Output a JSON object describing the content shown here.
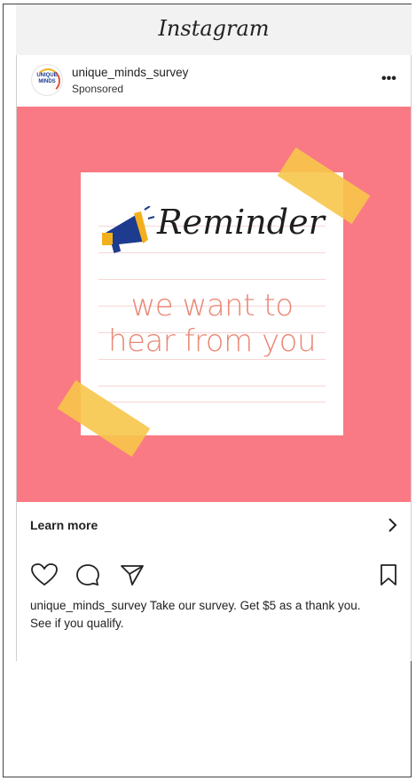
{
  "app": {
    "title": "Instagram"
  },
  "post": {
    "username": "unique_minds_survey",
    "sponsored_label": "Sponsored",
    "avatar_text": "UNIQUE MINDS",
    "more_label": "•••",
    "ad_image": {
      "title": "Reminder",
      "line1": "we want to",
      "line2": "hear from you",
      "background_color": "#f97a85",
      "tape_color": "#f7c64a"
    },
    "cta": {
      "label": "Learn more"
    },
    "caption": {
      "username": "unique_minds_survey",
      "text": "Take our survey. Get $5 as a thank you. See if you qualify."
    }
  },
  "icons": [
    "heart-icon",
    "comment-icon",
    "share-icon",
    "bookmark-icon",
    "chevron-right-icon",
    "megaphone-icon"
  ]
}
